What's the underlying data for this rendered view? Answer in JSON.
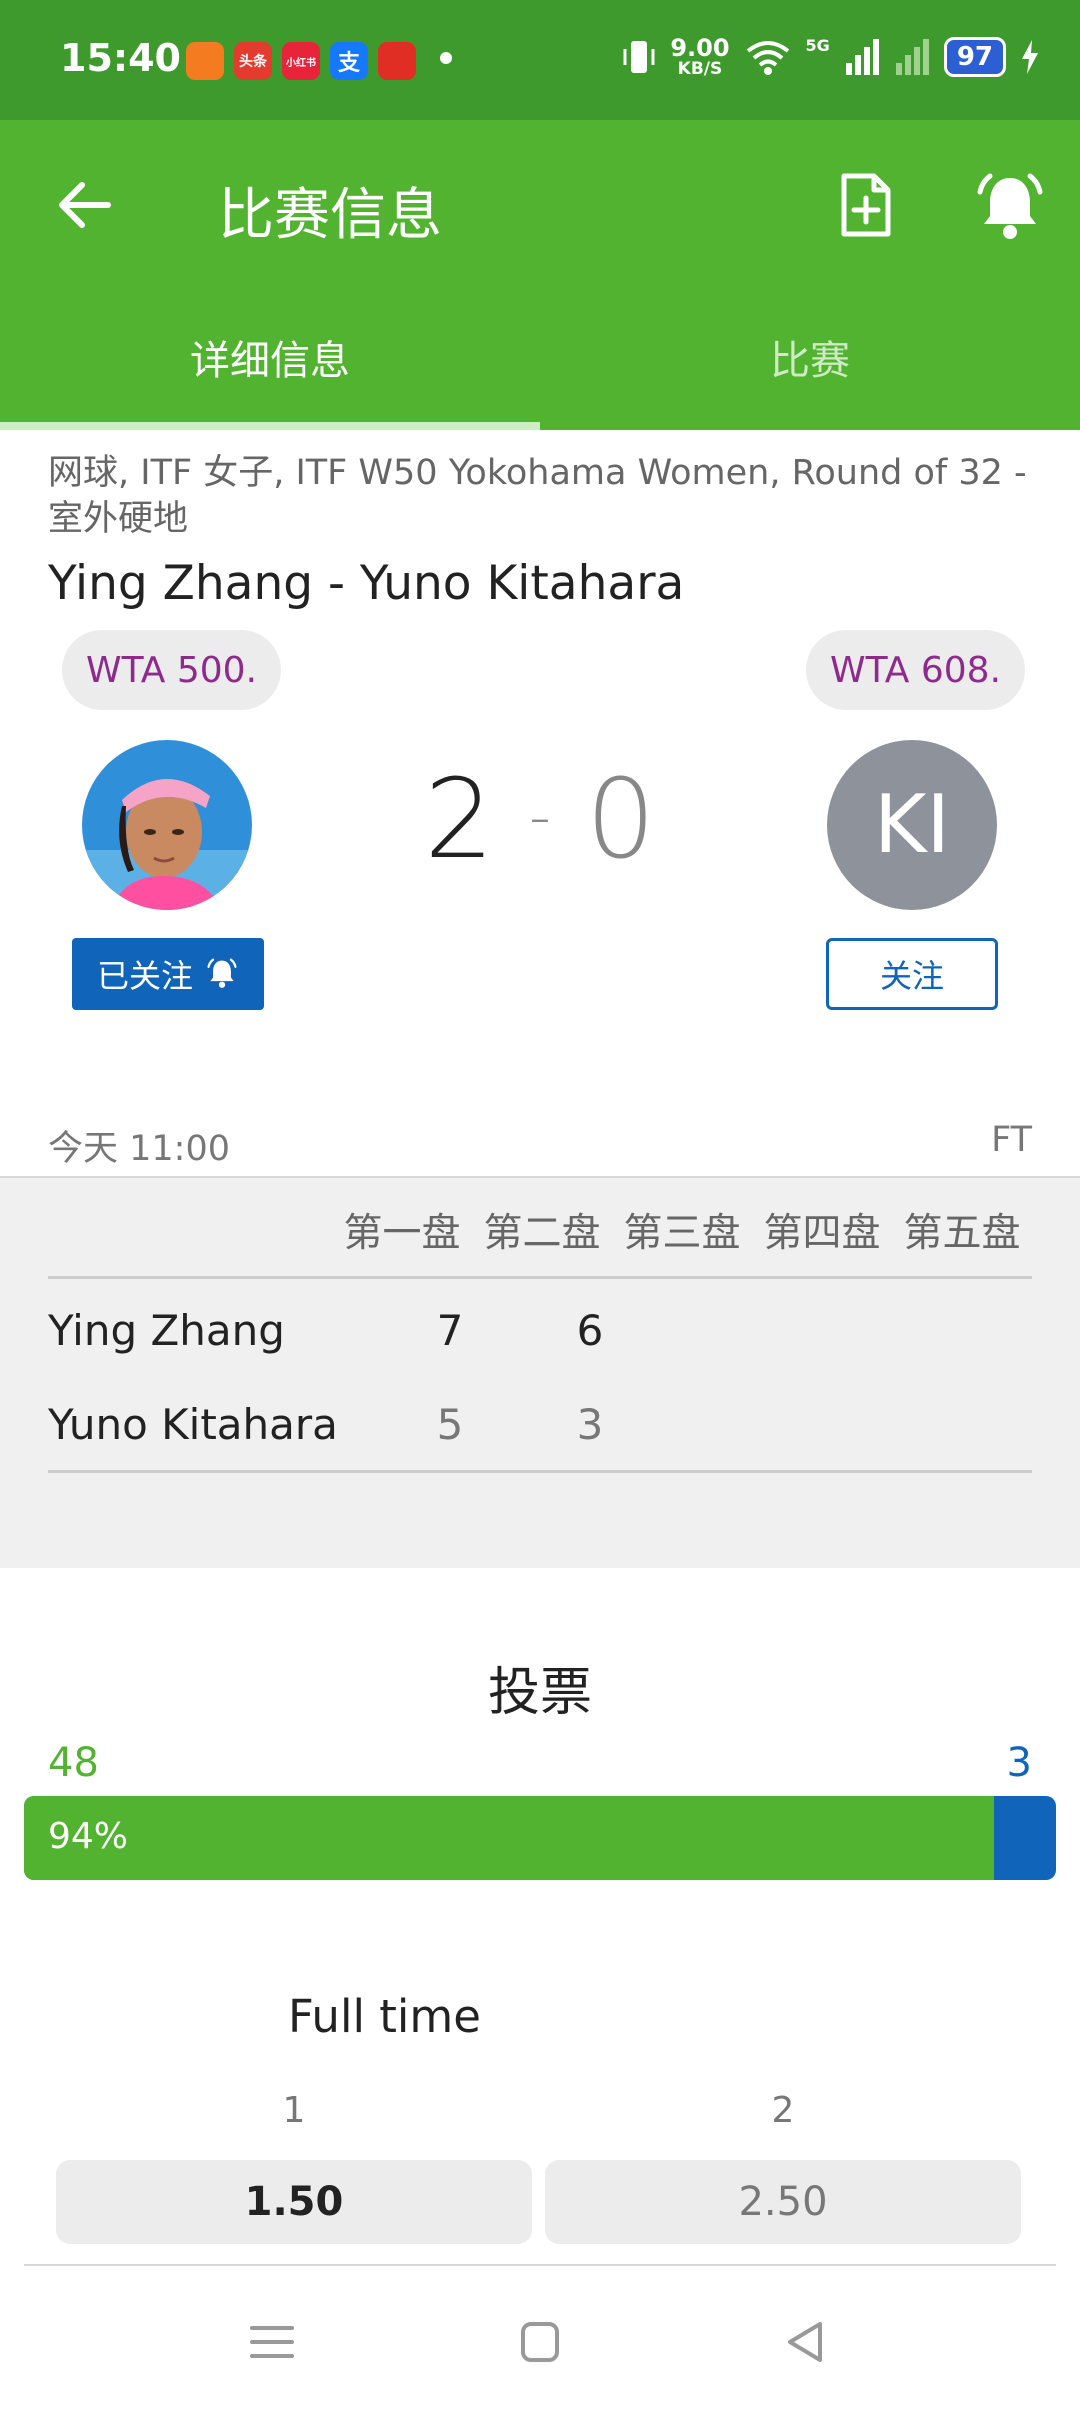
{
  "status_bar": {
    "time": "15:40",
    "apps": [
      {
        "icon": "app-orange-icon",
        "label": "",
        "color": "#f47b20"
      },
      {
        "icon": "toutiao-icon",
        "label": "头条",
        "color": "#e33b2e"
      },
      {
        "icon": "red-app-icon",
        "label": "小红书",
        "color": "#e8243b"
      },
      {
        "icon": "alipay-icon",
        "label": "支",
        "color": "#1677ff"
      },
      {
        "icon": "pinduoduo-icon",
        "label": "",
        "color": "#e02e24"
      }
    ],
    "speed_value": "9.00",
    "speed_unit": "KB/S",
    "network": "5G",
    "battery": "97"
  },
  "app_bar": {
    "title": "比赛信息",
    "tabs": [
      {
        "label": "详细信息",
        "active": true
      },
      {
        "label": "比赛",
        "active": false
      }
    ]
  },
  "match": {
    "competition": "网球, ITF 女子, ITF W50 Yokohama Women, Round of 32 - 室外硬地",
    "matchup": "Ying Zhang - Yuno Kitahara",
    "home_rank": "WTA 500.",
    "away_rank": "WTA 608.",
    "away_initials": "KI",
    "score_home": "2",
    "score_separator": "-",
    "score_away": "0",
    "followed_label": "已关注",
    "follow_label": "关注",
    "start_time": "今天 11:00",
    "status": "FT"
  },
  "sets": {
    "headers": [
      "第一盘",
      "第二盘",
      "第三盘",
      "第四盘",
      "第五盘"
    ],
    "rows": [
      {
        "player": "Ying Zhang",
        "set1": "7",
        "set2": "6"
      },
      {
        "player": "Yuno Kitahara",
        "set1": "5",
        "set2": "3"
      }
    ]
  },
  "votes": {
    "title": "投票",
    "home_count": "48",
    "away_count": "3",
    "home_percent_label": "94%",
    "home_fraction": 0.94,
    "home_color": "#52b331",
    "away_color": "#1064b9"
  },
  "odds": {
    "title": "Full time",
    "options": [
      {
        "label": "1",
        "value": "1.50"
      },
      {
        "label": "2",
        "value": "2.50"
      }
    ]
  },
  "colors": {
    "app_green": "#52b331",
    "status_green": "#3e9a2c",
    "accent_blue": "#1064b9",
    "rank_purple": "#8e2a8c"
  }
}
